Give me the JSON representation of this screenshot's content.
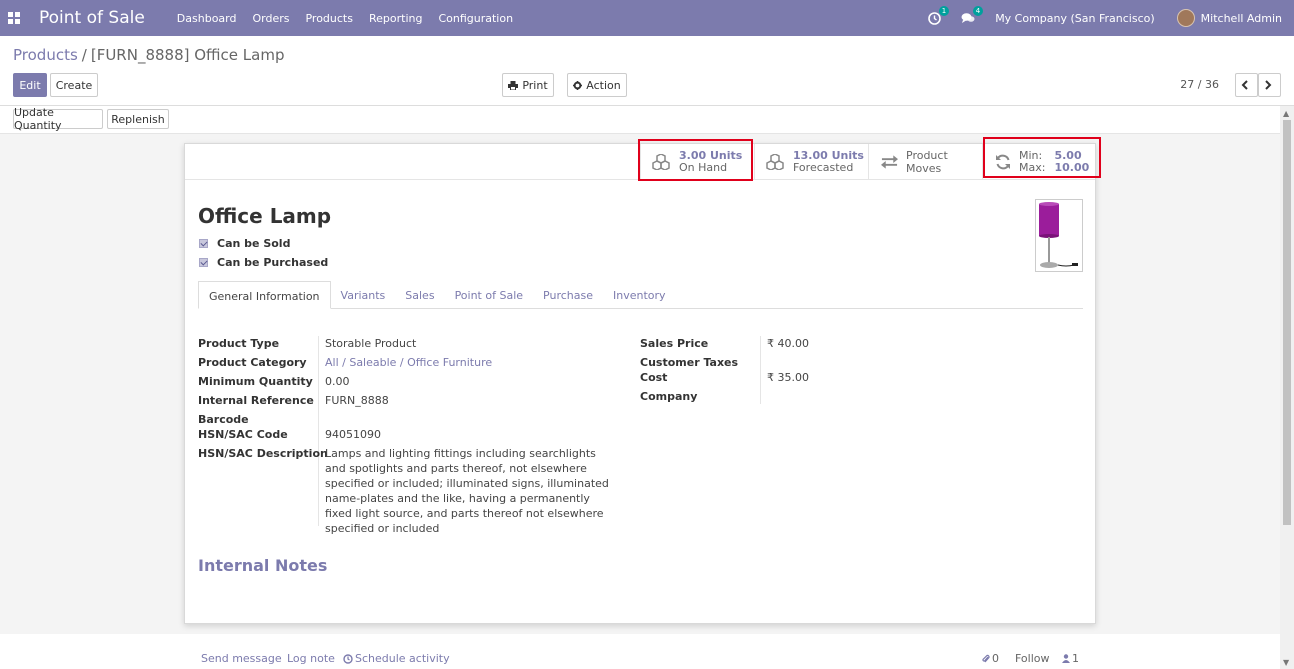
{
  "navbar": {
    "app_title": "Point of Sale",
    "menu": [
      "Dashboard",
      "Orders",
      "Products",
      "Reporting",
      "Configuration"
    ],
    "activity_badge": "1",
    "messages_badge": "4",
    "company": "My Company (San Francisco)",
    "user": "Mitchell Admin"
  },
  "breadcrumb": {
    "parent": "Products",
    "separator": "/",
    "current": "[FURN_8888] Office Lamp"
  },
  "buttons": {
    "edit": "Edit",
    "create": "Create",
    "print": "Print",
    "action": "Action",
    "update_quantity": "Update Quantity",
    "replenish": "Replenish"
  },
  "pager": {
    "value": "27 / 36"
  },
  "smart_buttons": {
    "on_hand_value": "3.00 Units",
    "on_hand_label": "On Hand",
    "forecasted_value": "13.00 Units",
    "forecasted_label": "Forecasted",
    "product_moves": "Product Moves",
    "min_label": "Min:",
    "min_value": "5.00",
    "max_label": "Max:",
    "max_value": "10.00"
  },
  "product": {
    "name": "Office Lamp",
    "can_be_sold": "Can be Sold",
    "can_be_purchased": "Can be Purchased"
  },
  "tabs": [
    "General Information",
    "Variants",
    "Sales",
    "Point of Sale",
    "Purchase",
    "Inventory"
  ],
  "fields": {
    "product_type_label": "Product Type",
    "product_type": "Storable Product",
    "product_category_label": "Product Category",
    "product_category": "All / Saleable / Office Furniture",
    "minimum_quantity_label": "Minimum Quantity",
    "minimum_quantity": "0.00",
    "internal_reference_label": "Internal Reference",
    "internal_reference": "FURN_8888",
    "barcode_label": "Barcode",
    "hsn_code_label": "HSN/SAC Code",
    "hsn_code": "94051090",
    "hsn_description_label": "HSN/SAC Description",
    "hsn_description": "Lamps and lighting fittings including searchlights and spotlights and parts thereof, not elsewhere specified or included; illuminated signs, illuminated name-plates and the like, having a permanently fixed light source, and parts thereof not elsewhere specified or included",
    "sales_price_label": "Sales Price",
    "sales_price": "₹ 40.00",
    "customer_taxes_label": "Customer Taxes",
    "cost_label": "Cost",
    "cost": "₹ 35.00",
    "company_label": "Company"
  },
  "internal_notes": "Internal Notes",
  "chatter": {
    "send_message": "Send message",
    "log_note": "Log note",
    "schedule_activity": "Schedule activity",
    "attachments": "0",
    "follow": "Follow",
    "followers": "1"
  },
  "colors": {
    "primary": "#7c7bad",
    "highlight": "#e0001b"
  }
}
